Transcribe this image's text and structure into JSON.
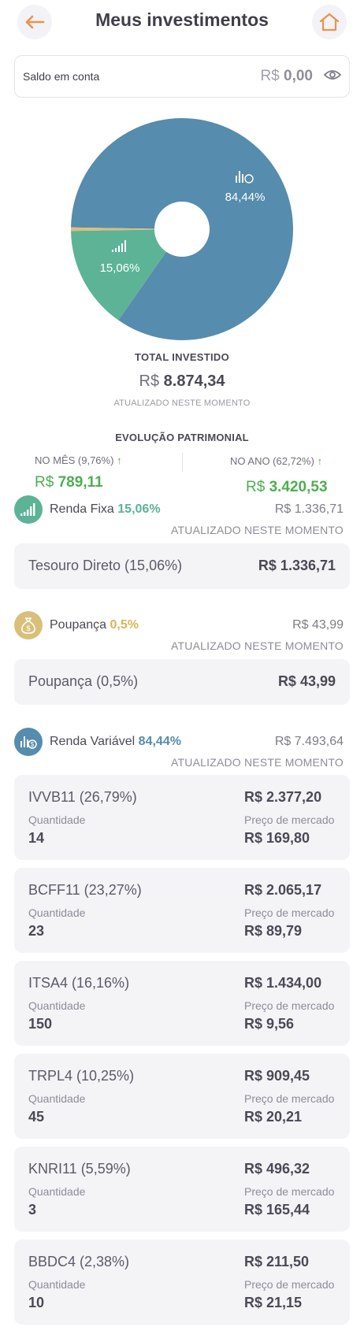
{
  "header": {
    "title": "Meus investimentos",
    "back_icon": "arrow-left-icon",
    "home_icon": "home-icon",
    "accent_color": "#e8954a"
  },
  "balance": {
    "label": "Saldo em conta",
    "currency": "R$",
    "amount": "0,00",
    "eye_icon": "eye-icon"
  },
  "chart_data": {
    "type": "pie",
    "slices": [
      {
        "label": "Renda Variável",
        "display": "84,44%",
        "value": 84.44,
        "color": "#568cad"
      },
      {
        "label": "Renda Fixa",
        "display": "15,06%",
        "value": 15.06,
        "color": "#5db396"
      },
      {
        "label": "Poupança",
        "display": "",
        "value": 0.5,
        "color": "#d9c07a"
      }
    ],
    "donut_hole": true
  },
  "total": {
    "title": "TOTAL INVESTIDO",
    "currency": "R$",
    "amount": "8.874,34",
    "updated": "ATUALIZADO NESTE MOMENTO"
  },
  "evolution": {
    "title": "EVOLUÇÃO PATRIMONIAL",
    "month_label": "NO MÊS (9,76%)",
    "month_currency": "R$",
    "month_value": "789,11",
    "year_label": "NO ANO (62,72%)",
    "year_currency": "R$",
    "year_value": "3.420,53",
    "arrow": "↑",
    "positive_color": "#4caf50"
  },
  "sections": {
    "fixed": {
      "name": "Renda Fixa",
      "pct": "15,06%",
      "total": "R$ 1.336,71",
      "updated": "ATUALIZADO NESTE MOMENTO",
      "icon": "signal-bars-icon",
      "color": "#5db396",
      "items": [
        {
          "name": "Tesouro Direto  (15,06%)",
          "value": "R$ 1.336,71"
        }
      ]
    },
    "savings": {
      "name": "Poupança",
      "pct": "0,5%",
      "total": "R$ 43,99",
      "updated": "ATUALIZADO NESTE MOMENTO",
      "icon": "money-bag-icon",
      "color": "#d9c07a",
      "items": [
        {
          "name": "Poupança  (0,5%)",
          "value": "R$ 43,99"
        }
      ]
    },
    "variable": {
      "name": "Renda Variável",
      "pct": "84,44%",
      "total": "R$ 7.493,64",
      "updated": "ATUALIZADO NESTE MOMENTO",
      "icon": "stock-coin-icon",
      "color": "#568cad"
    }
  },
  "assets": [
    {
      "name": "IVVB11  (26,79%)",
      "total": "R$ 2.377,20",
      "qty_label": "Quantidade",
      "qty": "14",
      "mkt_label": "Preço de mercado",
      "price": "R$ 169,80"
    },
    {
      "name": "BCFF11  (23,27%)",
      "total": "R$ 2.065,17",
      "qty_label": "Quantidade",
      "qty": "23",
      "mkt_label": "Preço de mercado",
      "price": "R$ 89,79"
    },
    {
      "name": "ITSA4  (16,16%)",
      "total": "R$ 1.434,00",
      "qty_label": "Quantidade",
      "qty": "150",
      "mkt_label": "Preço de mercado",
      "price": "R$ 9,56"
    },
    {
      "name": "TRPL4  (10,25%)",
      "total": "R$ 909,45",
      "qty_label": "Quantidade",
      "qty": "45",
      "mkt_label": "Preço de mercado",
      "price": "R$ 20,21"
    },
    {
      "name": "KNRI11  (5,59%)",
      "total": "R$ 496,32",
      "qty_label": "Quantidade",
      "qty": "3",
      "mkt_label": "Preço de mercado",
      "price": "R$ 165,44"
    },
    {
      "name": "BBDC4  (2,38%)",
      "total": "R$ 211,50",
      "qty_label": "Quantidade",
      "qty": "10",
      "mkt_label": "Preço de mercado",
      "price": "R$ 21,15"
    }
  ]
}
